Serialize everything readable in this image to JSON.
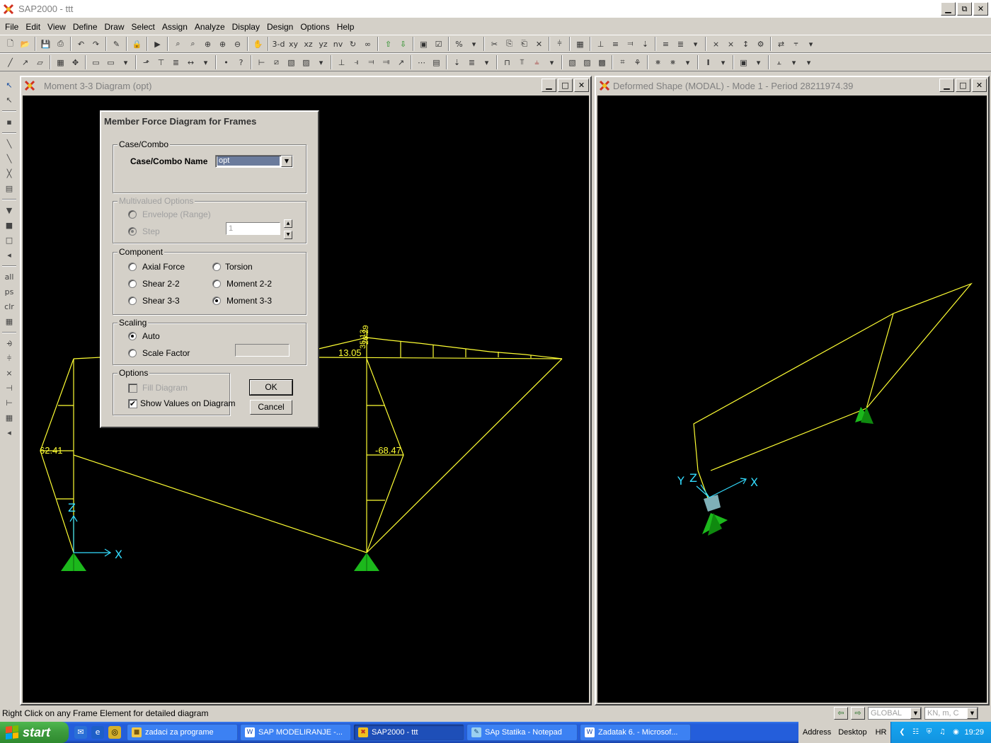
{
  "app": {
    "title": "SAP2000 - ttt",
    "accent": "#c03030"
  },
  "menu": [
    "File",
    "Edit",
    "View",
    "Define",
    "Draw",
    "Select",
    "Assign",
    "Analyze",
    "Display",
    "Design",
    "Options",
    "Help"
  ],
  "toolbar": {
    "view_3d_label": "3-d",
    "view_xy_label": "xy",
    "view_xz_label": "xz",
    "view_yz_label": "yz",
    "view_nv_label": "nv",
    "all_label": "all",
    "ps_label": "ps",
    "clr_label": "clr"
  },
  "left_window": {
    "title": "Moment 3-3 Diagram   (opt)",
    "labels": {
      "left_column_value": "62.41",
      "right_column_value": "-68.47",
      "beam_value": "13.05",
      "top_value_a": "35.13",
      "top_value_b": "26.29",
      "axis_x": "X",
      "axis_z": "Z"
    }
  },
  "right_window": {
    "title": "Deformed Shape (MODAL) - Mode 1 - Period 28211974.39",
    "axis_x": "X",
    "axis_y": "Y",
    "axis_z": "Z"
  },
  "dialog": {
    "title": "Member Force Diagram for Frames",
    "case_combo_group": "Case/Combo",
    "case_combo_label": "Case/Combo Name",
    "case_combo_value": "opt",
    "multivalued_group": "Multivalued Options",
    "envelope_label": "Envelope (Range)",
    "step_label": "Step",
    "step_value": "1",
    "component_group": "Component",
    "axial_label": "Axial Force",
    "torsion_label": "Torsion",
    "shear22_label": "Shear 2-2",
    "moment22_label": "Moment 2-2",
    "shear33_label": "Shear 3-3",
    "moment33_label": "Moment 3-3",
    "selected_component": "Moment 3-3",
    "scaling_group": "Scaling",
    "auto_label": "Auto",
    "scale_factor_label": "Scale Factor",
    "options_group": "Options",
    "fill_label": "Fill Diagram",
    "fill_checked": false,
    "show_values_label": "Show Values on Diagram",
    "show_values_checked": true,
    "ok_label": "OK",
    "cancel_label": "Cancel"
  },
  "status": {
    "text": "Right Click on any Frame Element for detailed diagram",
    "coord_system": "GLOBAL",
    "units": "KN, m, C"
  },
  "taskbar": {
    "start_label": "start",
    "tasks": [
      {
        "label": "zadaci za programe",
        "icon": "folder-icon"
      },
      {
        "label": "SAP  MODELIRANJE -...",
        "icon": "word-icon"
      },
      {
        "label": "SAP2000 - ttt",
        "icon": "sap-icon",
        "active": true
      },
      {
        "label": "SAp Statika - Notepad",
        "icon": "notepad-icon"
      },
      {
        "label": "Zadatak 6. - Microsof...",
        "icon": "word-icon"
      }
    ],
    "address_label": "Address",
    "desktop_label": "Desktop",
    "language": "HR",
    "clock": "19:29"
  },
  "colors": {
    "diagram_line": "#ffff33",
    "support": "#1cb81c",
    "axis": "#33ddff",
    "deformed_line": "#ffff33"
  }
}
